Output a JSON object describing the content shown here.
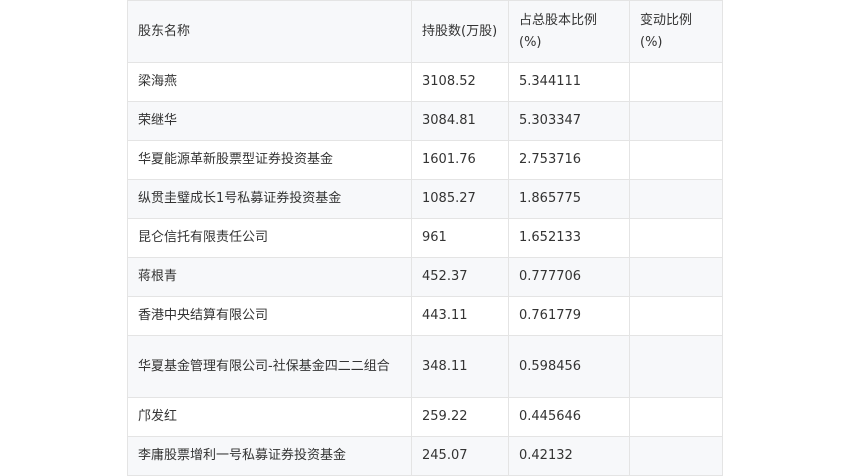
{
  "table": {
    "headers": [
      "股东名称",
      "持股数(万股)",
      "占总股本比例(%)",
      "变动比例(%)"
    ],
    "rows": [
      {
        "name": "梁海燕",
        "shares": "3108.52",
        "ratio": "5.344111",
        "change": ""
      },
      {
        "name": "荣继华",
        "shares": "3084.81",
        "ratio": "5.303347",
        "change": ""
      },
      {
        "name": "华夏能源革新股票型证券投资基金",
        "shares": "1601.76",
        "ratio": "2.753716",
        "change": ""
      },
      {
        "name": "纵贯圭璧成长1号私募证券投资基金",
        "shares": "1085.27",
        "ratio": "1.865775",
        "change": ""
      },
      {
        "name": "昆仑信托有限责任公司",
        "shares": "961",
        "ratio": "1.652133",
        "change": ""
      },
      {
        "name": "蒋根青",
        "shares": "452.37",
        "ratio": "0.777706",
        "change": ""
      },
      {
        "name": "香港中央结算有限公司",
        "shares": "443.11",
        "ratio": "0.761779",
        "change": ""
      },
      {
        "name": "华夏基金管理有限公司-社保基金四二二组合",
        "shares": "348.11",
        "ratio": "0.598456",
        "change": ""
      },
      {
        "name": "邝发红",
        "shares": "259.22",
        "ratio": "0.445646",
        "change": ""
      },
      {
        "name": "李庸股票增利一号私募证券投资基金",
        "shares": "245.07",
        "ratio": "0.42132",
        "change": ""
      }
    ]
  }
}
